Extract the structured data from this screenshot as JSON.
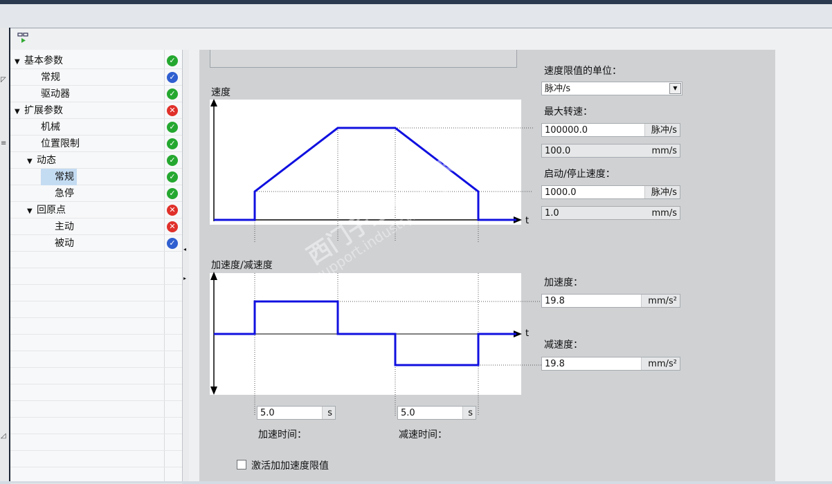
{
  "tree": {
    "items": [
      {
        "label": "基本参数",
        "level": 0,
        "expanded": true,
        "status": "ok",
        "selected": false
      },
      {
        "label": "常规",
        "level": 1,
        "status": "info",
        "selected": false
      },
      {
        "label": "驱动器",
        "level": 1,
        "status": "ok",
        "selected": false
      },
      {
        "label": "扩展参数",
        "level": 0,
        "expanded": true,
        "status": "error",
        "selected": false
      },
      {
        "label": "机械",
        "level": 1,
        "status": "ok",
        "selected": false
      },
      {
        "label": "位置限制",
        "level": 1,
        "status": "ok",
        "selected": false
      },
      {
        "label": "动态",
        "level": 1,
        "expanded": true,
        "status": "ok",
        "selected": false
      },
      {
        "label": "常规",
        "level": 2,
        "status": "ok",
        "selected": true
      },
      {
        "label": "急停",
        "level": 2,
        "status": "ok",
        "selected": false
      },
      {
        "label": "回原点",
        "level": 1,
        "expanded": true,
        "status": "error",
        "selected": false
      },
      {
        "label": "主动",
        "level": 2,
        "status": "error",
        "selected": false
      },
      {
        "label": "被动",
        "level": 2,
        "status": "info",
        "selected": false
      }
    ]
  },
  "velocity_chart": {
    "title": "速度",
    "t_label": "t",
    "color": "#1010e0"
  },
  "accel_chart": {
    "title": "加速度/减速度",
    "t_label": "t",
    "color": "#1010e0"
  },
  "params": {
    "speed_unit_label": "速度限值的单位：",
    "speed_unit_value": "脉冲/s",
    "max_speed_label": "最大转速：",
    "max_speed_value": "100000.0",
    "max_speed_unit": "脉冲/s",
    "max_speed_mm_value": "100.0",
    "max_speed_mm_unit": "mm/s",
    "start_stop_label": "启动/停止速度：",
    "start_stop_value": "1000.0",
    "start_stop_unit": "脉冲/s",
    "start_stop_mm_value": "1.0",
    "start_stop_mm_unit": "mm/s",
    "accel_label": "加速度：",
    "accel_value": "19.8",
    "accel_unit": "mm/s²",
    "decel_label": "减速度：",
    "decel_value": "19.8",
    "decel_unit": "mm/s²",
    "accel_time_label": "加速时间：",
    "accel_time_value": "5.0",
    "accel_time_unit": "s",
    "decel_time_label": "减速时间：",
    "decel_time_value": "5.0",
    "decel_time_unit": "s",
    "jerk_limit_label": "激活加加速度限值",
    "jerk_limit_checked": false
  },
  "watermark": {
    "line1": "西门子工业  技术论坛",
    "line2": "support.industry.siemens.com/cs"
  }
}
